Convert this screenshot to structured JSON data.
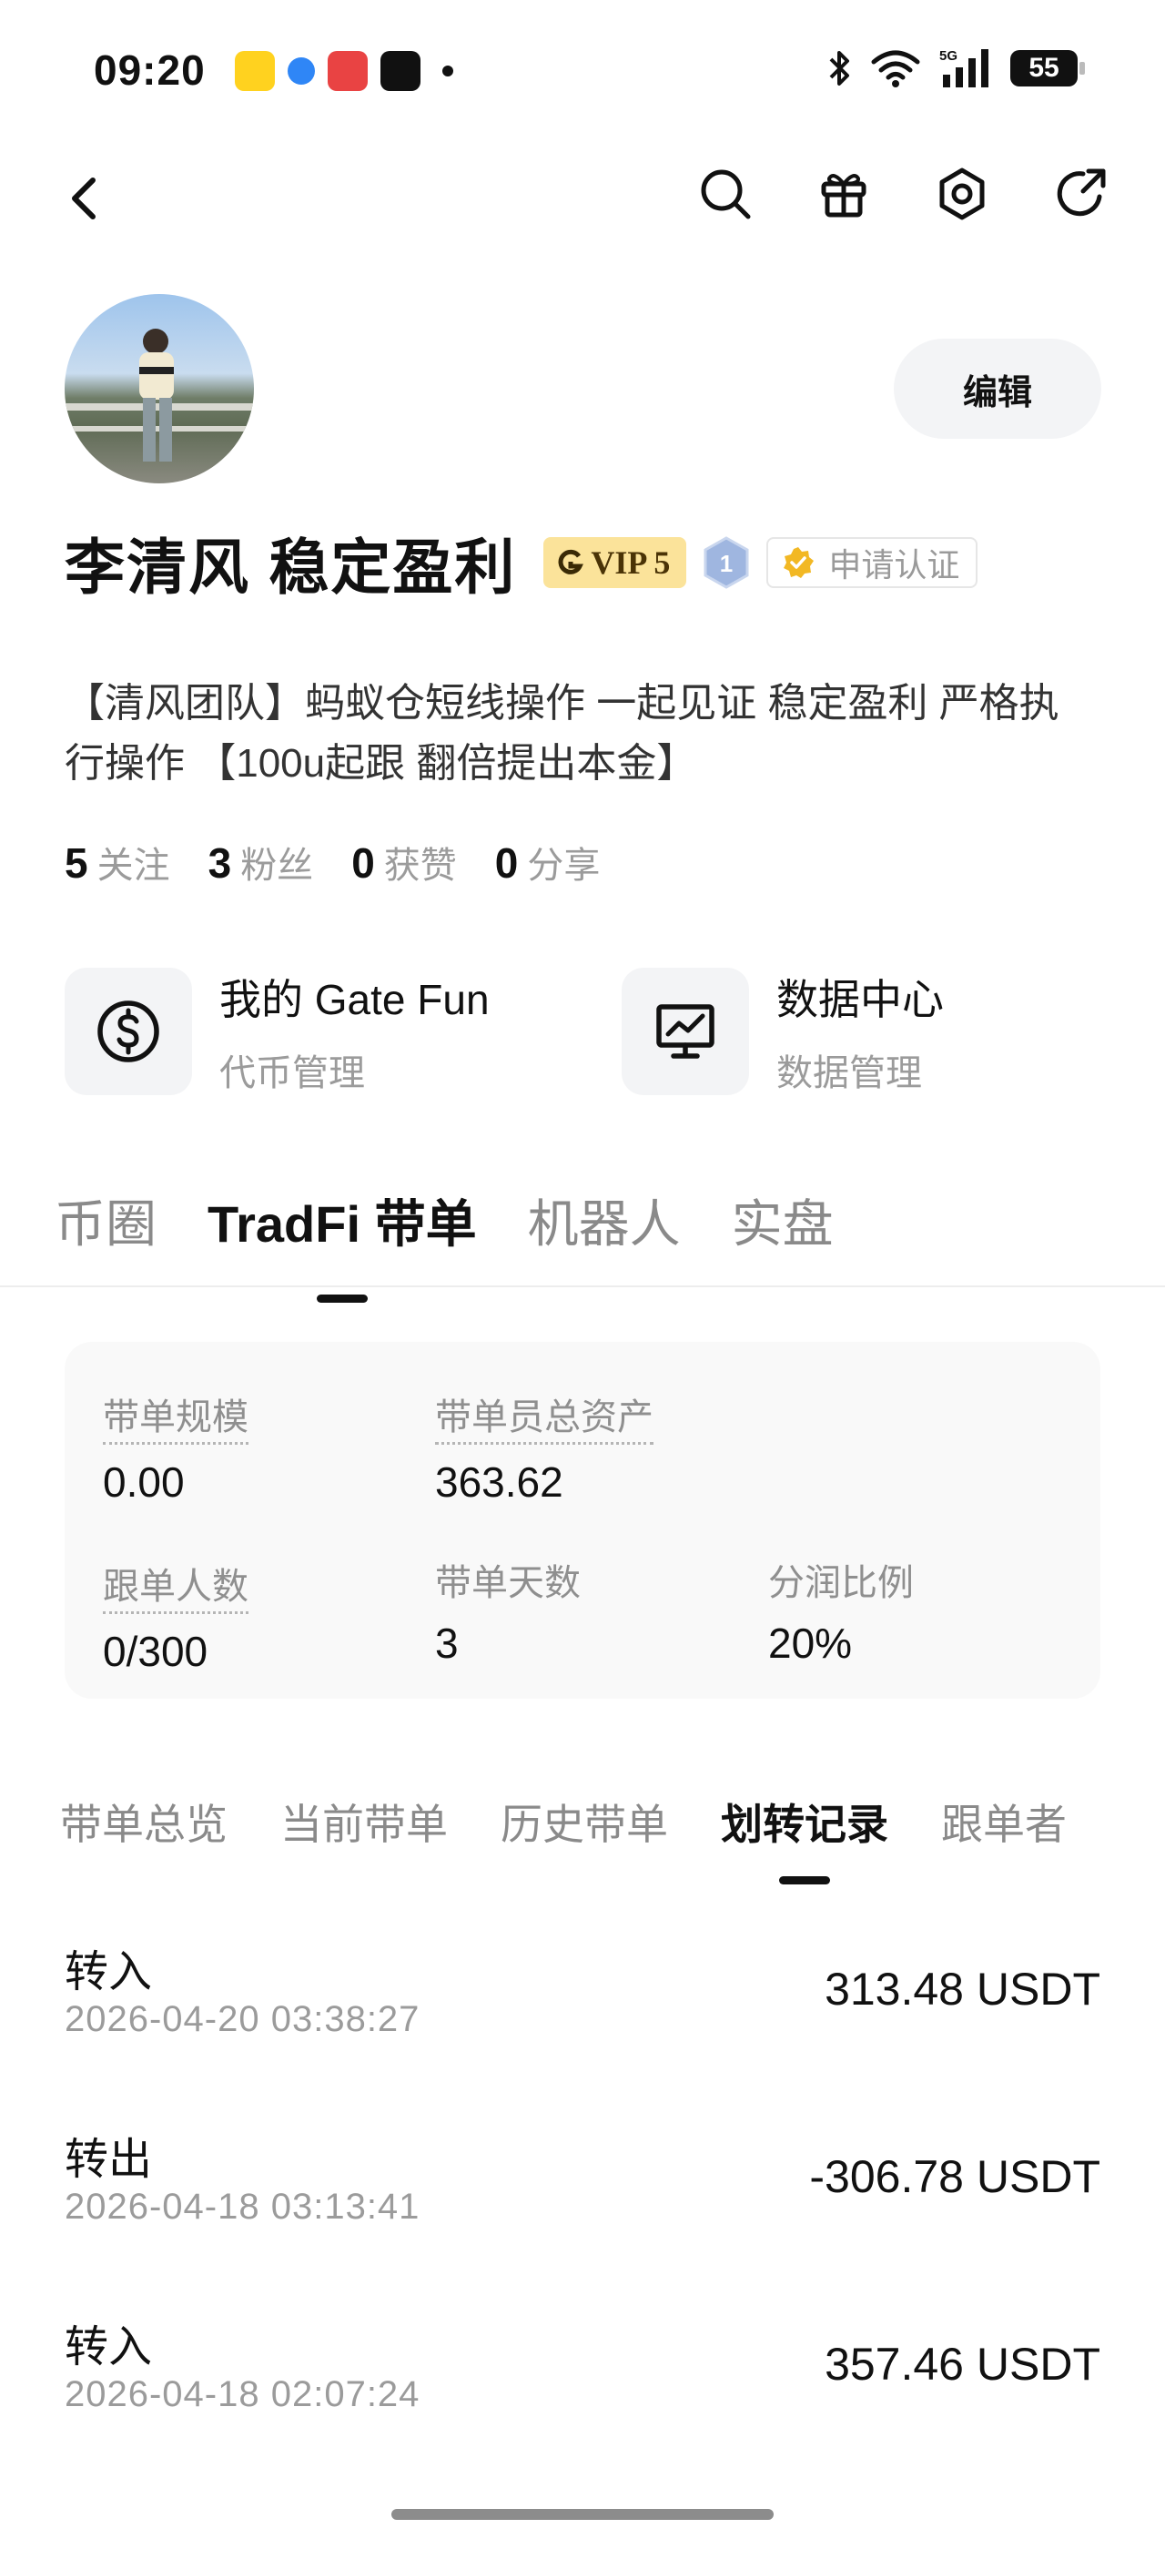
{
  "status_bar": {
    "time": "09:20",
    "battery": "55"
  },
  "profile": {
    "name": "李清风 稳定盈利",
    "vip": "VIP 5",
    "level": "1",
    "verify": "申请认证",
    "edit_label": "编辑",
    "bio": "【清风团队】蚂蚁仓短线操作 一起见证 稳定盈利 严格执行操作 【100u起跟 翻倍提出本金】",
    "stats": [
      {
        "num": "5",
        "label": "关注"
      },
      {
        "num": "3",
        "label": "粉丝"
      },
      {
        "num": "0",
        "label": "获赞"
      },
      {
        "num": "0",
        "label": "分享"
      }
    ]
  },
  "tools": [
    {
      "title": "我的 Gate Fun",
      "sub": "代币管理",
      "icon": "dollar-icon"
    },
    {
      "title": "数据中心",
      "sub": "数据管理",
      "icon": "chart-monitor-icon"
    }
  ],
  "main_tabs": [
    "币圈",
    "TradFi 带单",
    "机器人",
    "实盘"
  ],
  "main_tab_active": 1,
  "summary": {
    "scale_label": "带单规模",
    "scale_value": "0.00",
    "assets_label": "带单员总资产",
    "assets_value": "363.62",
    "followers_label": "跟单人数",
    "followers_value": "0/300",
    "days_label": "带单天数",
    "days_value": "3",
    "share_label": "分润比例",
    "share_value": "20%"
  },
  "sub_tabs": [
    "带单总览",
    "当前带单",
    "历史带单",
    "划转记录",
    "跟单者"
  ],
  "sub_tab_active": 3,
  "records": [
    {
      "type": "转入",
      "time": "2026-04-20 03:38:27",
      "amount": "313.48 USDT"
    },
    {
      "type": "转出",
      "time": "2026-04-18 03:13:41",
      "amount": "-306.78 USDT"
    },
    {
      "type": "转入",
      "time": "2026-04-18 02:07:24",
      "amount": "357.46 USDT"
    }
  ],
  "colors": {
    "vip_bg": "#fbe39a",
    "verify_check": "#f2b824",
    "level_badge": "#9fb6e0"
  }
}
